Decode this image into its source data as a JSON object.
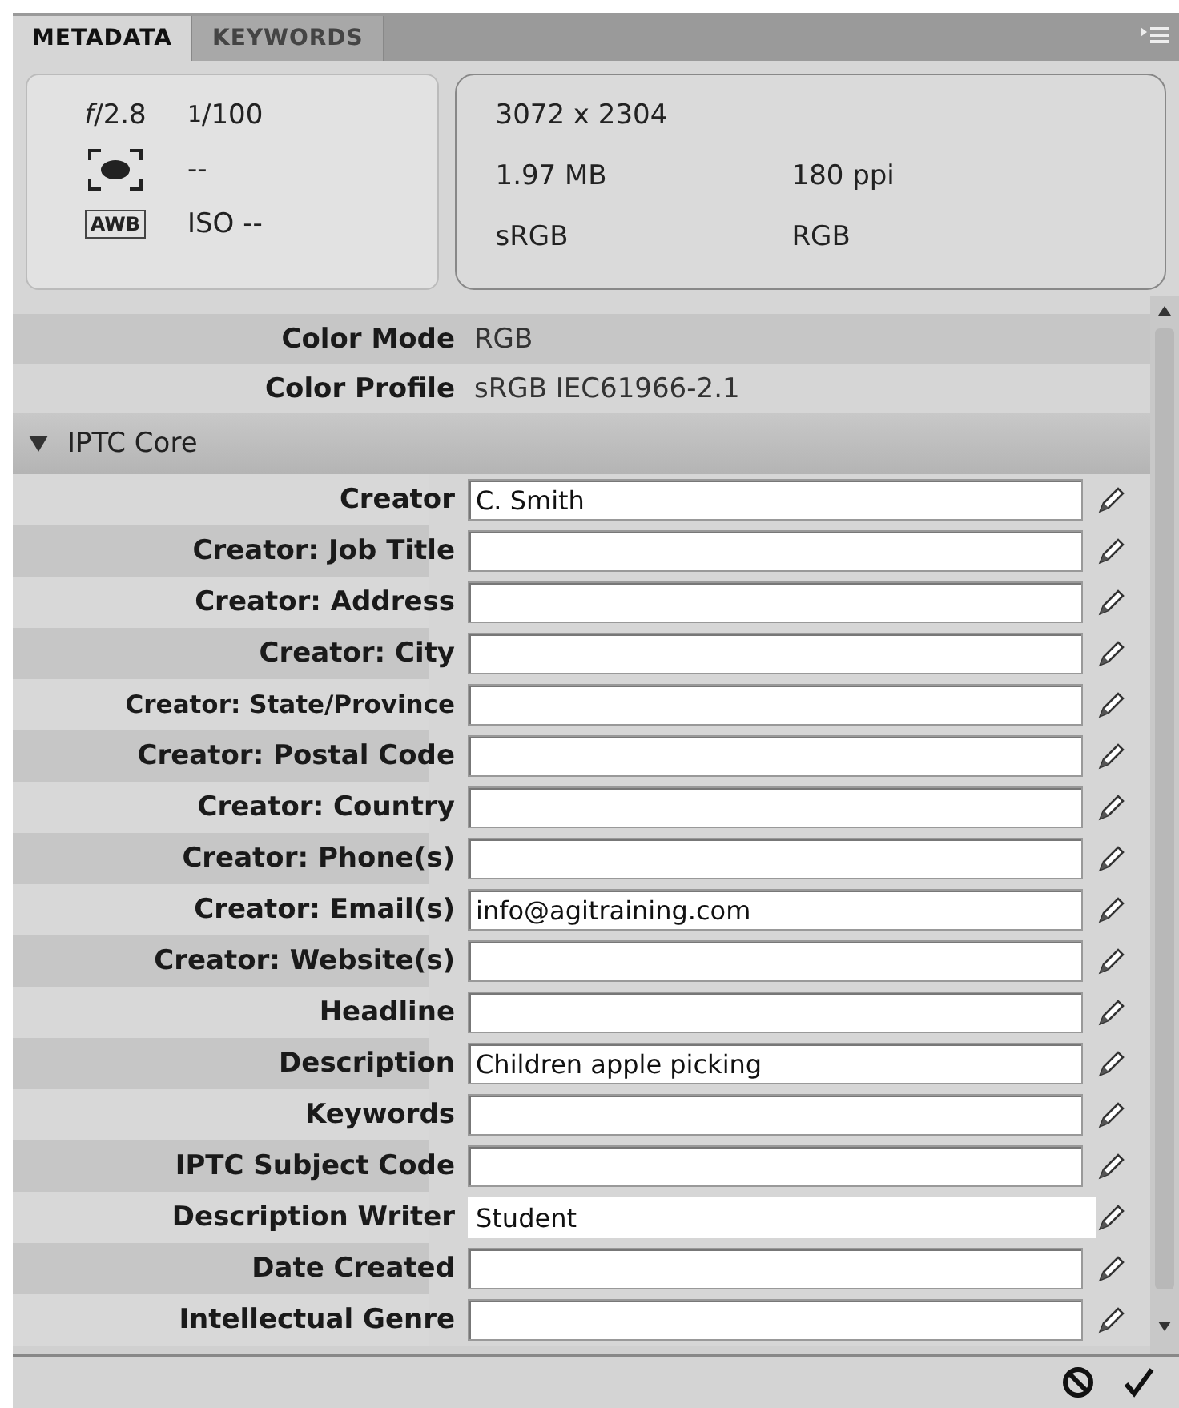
{
  "tabs": [
    {
      "label": "METADATA",
      "selected": true
    },
    {
      "label": "KEYWORDS",
      "selected": false
    }
  ],
  "camera": {
    "aperture": "*f*/2.8",
    "shutter": "$^{1}$/100",
    "metering": "--",
    "white_balance": "AWB",
    "iso": "ISO --"
  },
  "file_info": {
    "dimensions": "3072 x 2304",
    "size": "1.97 MB",
    "resolution": "180 ppi",
    "profile": "sRGB",
    "mode": "RGB"
  },
  "properties": [
    {
      "label": "Color Mode",
      "value": "RGB"
    },
    {
      "label": "Color Profile",
      "value": "sRGB IEC61966-2.1"
    }
  ],
  "section": {
    "title": "IPTC Core",
    "expanded": true
  },
  "fields": [
    {
      "label": "Creator",
      "value": "C. Smith",
      "focused": false
    },
    {
      "label": "Creator: Job Title",
      "focused": false
    },
    {
      "label": "Creator: Address",
      "focused": false
    },
    {
      "label": "Creator: City",
      "focused": false
    },
    {
      "label": "Creator: State/Province",
      "focused": false
    },
    {
      "label": "Creator: Postal Code",
      "focused": false
    },
    {
      "label": "Creator: Country",
      "focused": false
    },
    {
      "label": "Creator: Phone(s)",
      "focused": false
    },
    {
      "label": "Creator: Email(s)",
      "value": "info@agitraining.com",
      "focused": false
    },
    {
      "label": "Creator: Website(s)",
      "focused": false
    },
    {
      "label": "Headline",
      "focused": false
    },
    {
      "label": "Description",
      "value": "Children apple picking",
      "focused": false
    },
    {
      "label": "Keywords",
      "focused": false
    },
    {
      "label": "IPTC Subject Code",
      "focused": false
    },
    {
      "label": "Description Writer",
      "value": "Student",
      "focused": true
    },
    {
      "label": "Date Created",
      "focused": false
    },
    {
      "label": "Intellectual Genre",
      "focused": false
    }
  ]
}
